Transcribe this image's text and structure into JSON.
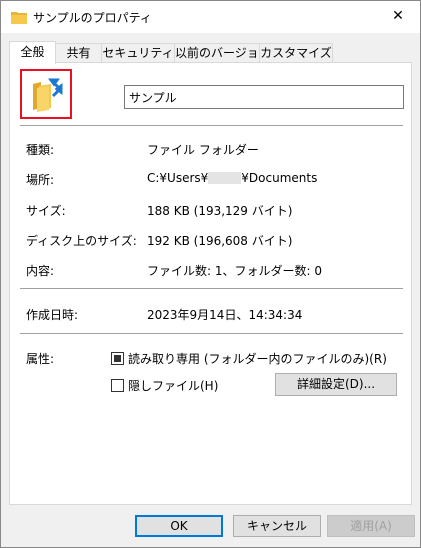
{
  "window": {
    "title": "サンプルのプロパティ",
    "close_symbol": "✕"
  },
  "tabs": [
    {
      "label": "全般",
      "active": true
    },
    {
      "label": "共有",
      "active": false
    },
    {
      "label": "セキュリティ",
      "active": false
    },
    {
      "label": "以前のバージョン",
      "active": false
    },
    {
      "label": "カスタマイズ",
      "active": false
    }
  ],
  "general": {
    "folder_name": "サンプル",
    "type": {
      "label": "種類:",
      "value": "ファイル フォルダー"
    },
    "location": {
      "label": "場所:",
      "value_prefix": "C:¥Users¥",
      "value_suffix": "¥Documents"
    },
    "size": {
      "label": "サイズ:",
      "value": "188 KB (193,129 バイト)"
    },
    "size_on_disk": {
      "label": "ディスク上のサイズ:",
      "value": "192 KB (196,608 バイト)"
    },
    "contents": {
      "label": "内容:",
      "value": "ファイル数: 1、フォルダー数: 0"
    },
    "created": {
      "label": "作成日時:",
      "value": "2023年9月14日、14:34:34"
    },
    "attributes": {
      "label": "属性:",
      "readonly_label": "読み取り専用 (フォルダー内のファイルのみ)(R)",
      "hidden_label": "隠しファイル(H)",
      "advanced_button": "詳細設定(D)..."
    }
  },
  "footer": {
    "ok": "OK",
    "cancel": "キャンセル",
    "apply": "適用(A)"
  },
  "colors": {
    "highlight_box": "#e81123",
    "default_button_border": "#0078d7",
    "folder_yellow": "#f6c94d",
    "arrow_blue": "#1e78d2"
  }
}
